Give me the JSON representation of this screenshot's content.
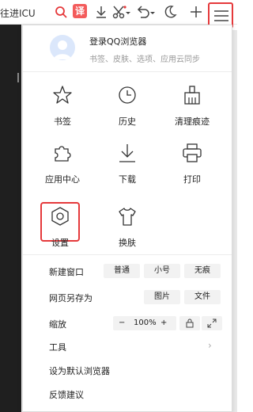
{
  "toolbar": {
    "site_text": "往进ICU",
    "translate_label": "译"
  },
  "login": {
    "title": "登录QQ浏览器",
    "subtitle": "书签、皮肤、选项、应用云同步"
  },
  "grid": {
    "bookmarks": "书签",
    "history": "历史",
    "clear_traces": "清理痕迹",
    "app_center": "应用中心",
    "download": "下载",
    "print": "打印",
    "settings": "设置",
    "skin": "换肤"
  },
  "rows": {
    "new_window": {
      "label": "新建窗口",
      "options": [
        "普通",
        "小号",
        "无痕"
      ]
    },
    "save_page": {
      "label": "网页另存为",
      "options": [
        "图片",
        "文件"
      ]
    },
    "zoom": {
      "label": "缩放",
      "minus": "−",
      "value": "100%",
      "plus": "+"
    },
    "tools": {
      "label": "工具",
      "chevron": "›"
    },
    "set_default": {
      "label": "设为默认浏览器"
    },
    "feedback": {
      "label": "反馈建议"
    }
  },
  "colors": {
    "highlight": "#e5393b",
    "translate_bg": "#f35b5b"
  }
}
